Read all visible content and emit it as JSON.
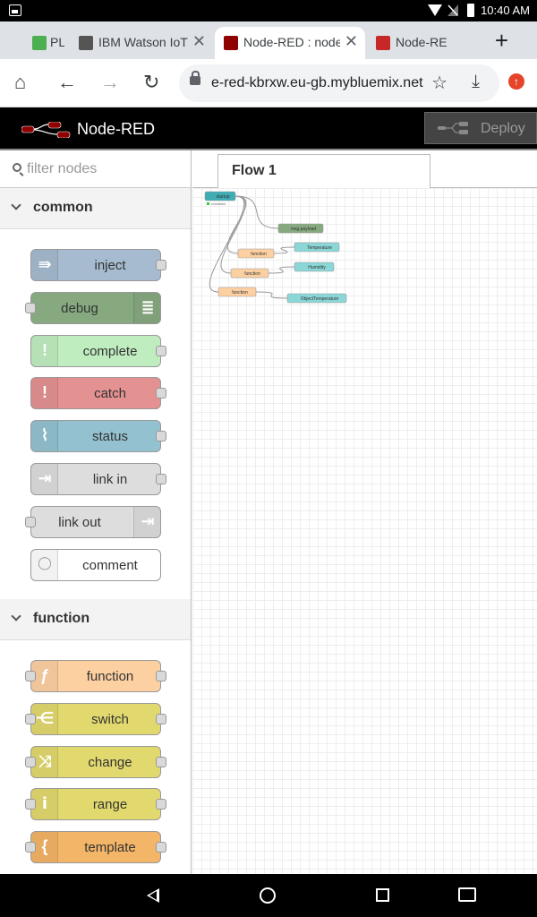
{
  "status_bar": {
    "time": "10:40 AM"
  },
  "browser": {
    "tabs": [
      {
        "label": "PL",
        "favicon_color": "#4caf50",
        "active": false
      },
      {
        "label": "IBM Watson IoT",
        "favicon_color": "#555555",
        "active": false
      },
      {
        "label": "Node-RED : node",
        "favicon_color": "#8f0000",
        "active": true
      },
      {
        "label": "Node-RED",
        "favicon_color": "#c62828",
        "active": false
      }
    ],
    "url": "e-red-kbrxw.eu-gb.mybluemix.net",
    "icons": [
      "home-icon",
      "back-icon",
      "forward-icon",
      "reload-icon",
      "lock-icon",
      "star-icon",
      "download-icon",
      "update-icon"
    ]
  },
  "nodered": {
    "title": "Node-RED",
    "deploy_label": "Deploy",
    "search_placeholder": "filter nodes",
    "flow_tab": "Flow 1",
    "categories": [
      {
        "label": "common",
        "nodes": [
          {
            "label": "inject",
            "color": "#a6bbcf",
            "icon": "arrow-in-icon",
            "glyph": "⇛",
            "port": "out",
            "icon_side": "left"
          },
          {
            "label": "debug",
            "color": "#87a980",
            "icon": "list-icon",
            "glyph": "≣",
            "port": "in",
            "icon_side": "right"
          },
          {
            "label": "complete",
            "color": "#c0edc0",
            "icon": "exclamation-icon",
            "glyph": "!",
            "port": "out",
            "icon_side": "left"
          },
          {
            "label": "catch",
            "color": "#e49191",
            "icon": "exclamation-icon",
            "glyph": "!",
            "port": "out",
            "icon_side": "left"
          },
          {
            "label": "status",
            "color": "#94c1d0",
            "icon": "pulse-icon",
            "glyph": "⌇",
            "port": "out",
            "icon_side": "left"
          },
          {
            "label": "link in",
            "color": "#dddddd",
            "icon": "link-in-icon",
            "glyph": "⇥",
            "port": "out",
            "icon_side": "left"
          },
          {
            "label": "link out",
            "color": "#dddddd",
            "icon": "link-out-icon",
            "glyph": "⇥",
            "port": "in",
            "icon_side": "right"
          },
          {
            "label": "comment",
            "color": "#ffffff",
            "icon": "speech-bubble-icon",
            "glyph": "◯",
            "port": "none",
            "icon_side": "left"
          }
        ]
      },
      {
        "label": "function",
        "nodes": [
          {
            "label": "function",
            "color": "#fdd0a2",
            "icon": "function-icon",
            "glyph": "ƒ",
            "port": "both",
            "icon_side": "left"
          },
          {
            "label": "switch",
            "color": "#e2d96e",
            "icon": "switch-icon",
            "glyph": "⋲",
            "port": "both",
            "icon_side": "left"
          },
          {
            "label": "change",
            "color": "#e2d96e",
            "icon": "shuffle-icon",
            "glyph": "⤨",
            "port": "both",
            "icon_side": "left"
          },
          {
            "label": "range",
            "color": "#e2d96e",
            "icon": "range-icon",
            "glyph": "ⅰ",
            "port": "both",
            "icon_side": "left"
          },
          {
            "label": "template",
            "color": "#f3b567",
            "icon": "brace-icon",
            "glyph": "{",
            "port": "both",
            "icon_side": "left"
          }
        ]
      }
    ],
    "flow_nodes": [
      {
        "label": "startup",
        "color": "#3FADB5",
        "subtitle": "connected"
      },
      {
        "label": "msg.payload",
        "color": "#87a980"
      },
      {
        "label": "function",
        "color": "#fdd0a2"
      },
      {
        "label": "Temperature",
        "color": "#8bd6d6"
      },
      {
        "label": "function",
        "color": "#fdd0a2"
      },
      {
        "label": "Humidity",
        "color": "#8bd6d6"
      },
      {
        "label": "function",
        "color": "#fdd0a2"
      },
      {
        "label": "ObjectTemperature",
        "color": "#8bd6d6"
      }
    ]
  }
}
